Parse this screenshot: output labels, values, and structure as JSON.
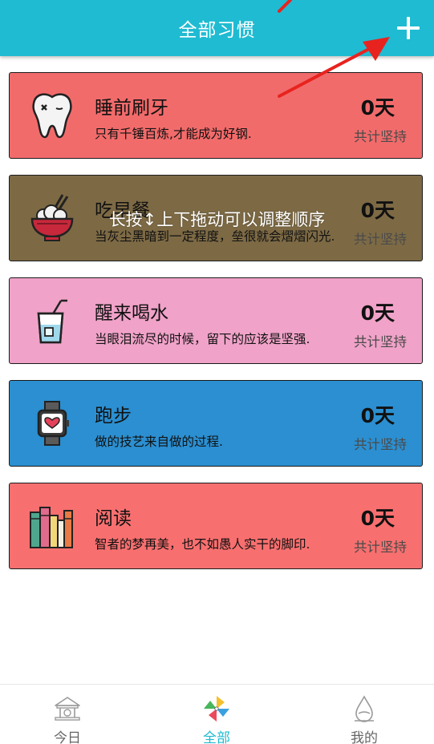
{
  "header": {
    "title": "全部习惯",
    "background": "#1fbbd2",
    "add_icon": "plus-icon"
  },
  "toast": {
    "text": "长按↕上下拖动可以调整顺序"
  },
  "habits": [
    {
      "title": "睡前刷牙",
      "quote": "只有千锤百炼,才能成为好钢.",
      "days": "0天",
      "days_label": "共计坚持",
      "color": "#f26b6b",
      "icon": "tooth-icon"
    },
    {
      "title": "吃早餐",
      "quote": "当灰尘黑暗到一定程度，垒很就会熠熠闪光.",
      "days": "0天",
      "days_label": "共计坚持",
      "color": "#7d6a45",
      "icon": "rice-bowl-icon"
    },
    {
      "title": "醒来喝水",
      "quote": "当眼泪流尽的时候，留下的应该是坚强.",
      "days": "0天",
      "days_label": "共计坚持",
      "color": "#f0a2c8",
      "icon": "drink-glass-icon"
    },
    {
      "title": "跑步",
      "quote": "做的技艺来自做的过程.",
      "days": "0天",
      "days_label": "共计坚持",
      "color": "#2b8fd1",
      "icon": "smartwatch-icon"
    },
    {
      "title": "阅读",
      "quote": "智者的梦再美，也不如愚人实干的脚印.",
      "days": "0天",
      "days_label": "共计坚持",
      "color": "#f86f6f",
      "icon": "books-icon"
    }
  ],
  "nav": {
    "items": [
      {
        "label": "今日",
        "icon": "temple-icon",
        "active": false
      },
      {
        "label": "全部",
        "icon": "pinwheel-icon",
        "active": true
      },
      {
        "label": "我的",
        "icon": "droplet-icon",
        "active": false
      }
    ]
  }
}
